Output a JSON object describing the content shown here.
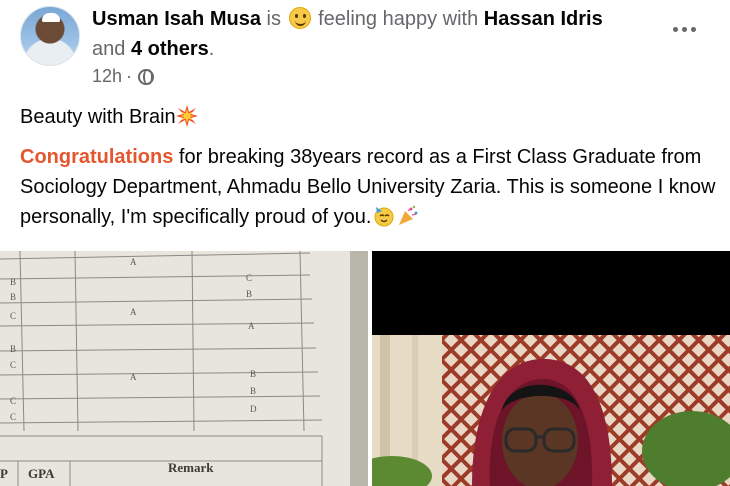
{
  "post": {
    "author": "Usman Isah Musa",
    "is_text": "is",
    "feeling_text": "feeling happy with",
    "tagged": "Hassan Idris",
    "and_text": "and",
    "others": "4 others",
    "period": ".",
    "time": "12h",
    "separator": "·",
    "audience_icon": "globe-icon",
    "line1": "Beauty with Brain",
    "congrats": "Congratulations",
    "message": " for breaking 38years record as a First Class Graduate from Sociology Department, Ahmadu Bello University Zaria. This is someone I know personally, I'm specifically proud of you."
  },
  "document_photo": {
    "grades_col1": [
      "B",
      "B",
      "C",
      "B",
      "C",
      "C",
      "C"
    ],
    "grades_col2": [
      "A",
      "A",
      "A"
    ],
    "grades_col3": [
      "C",
      "B",
      "A",
      "B",
      "B",
      "D"
    ],
    "footer_headers": [
      "P",
      "GPA",
      "Remark"
    ]
  },
  "colors": {
    "highlight": "#e4572e",
    "muted": "#65676b"
  }
}
